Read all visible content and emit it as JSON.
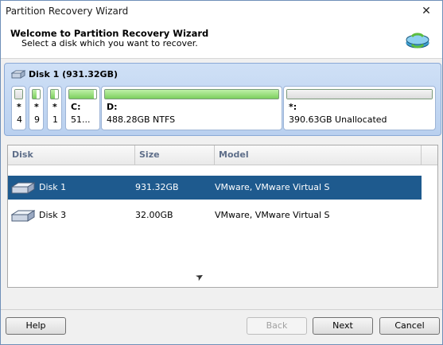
{
  "window": {
    "title": "Partition Recovery Wizard"
  },
  "header": {
    "title": "Welcome to Partition Recovery Wizard",
    "subtitle": "Select a disk which you want to recover."
  },
  "disk_map": {
    "label": "Disk 1 (931.32GB)",
    "partitions": [
      {
        "line1": "*",
        "line2": "4",
        "used_fraction": 0.0
      },
      {
        "line1": "*",
        "line2": "9",
        "used_fraction": 0.6
      },
      {
        "line1": "*",
        "line2": "1",
        "used_fraction": 0.6
      },
      {
        "line1": "C:",
        "line2": "51...",
        "used_fraction": 0.9
      },
      {
        "line1": "D:",
        "line2": "488.28GB NTFS",
        "used_fraction": 1.0
      },
      {
        "line1": "*:",
        "line2": "390.63GB Unallocated",
        "used_fraction": 0.0
      }
    ]
  },
  "table": {
    "columns": [
      "Disk",
      "Size",
      "Model"
    ],
    "rows": [
      {
        "disk": "Disk 1",
        "size": "931.32GB",
        "model": "VMware, VMware Virtual S",
        "selected": true
      },
      {
        "disk": "Disk 3",
        "size": "32.00GB",
        "model": "VMware, VMware Virtual S",
        "selected": false
      }
    ]
  },
  "buttons": {
    "help": "Help",
    "back": "Back",
    "next": "Next",
    "cancel": "Cancel"
  },
  "colors": {
    "selection": "#1e5a8e",
    "used_fill": "#7ccf5e",
    "disk_map_bg": "#c4d8f2"
  }
}
